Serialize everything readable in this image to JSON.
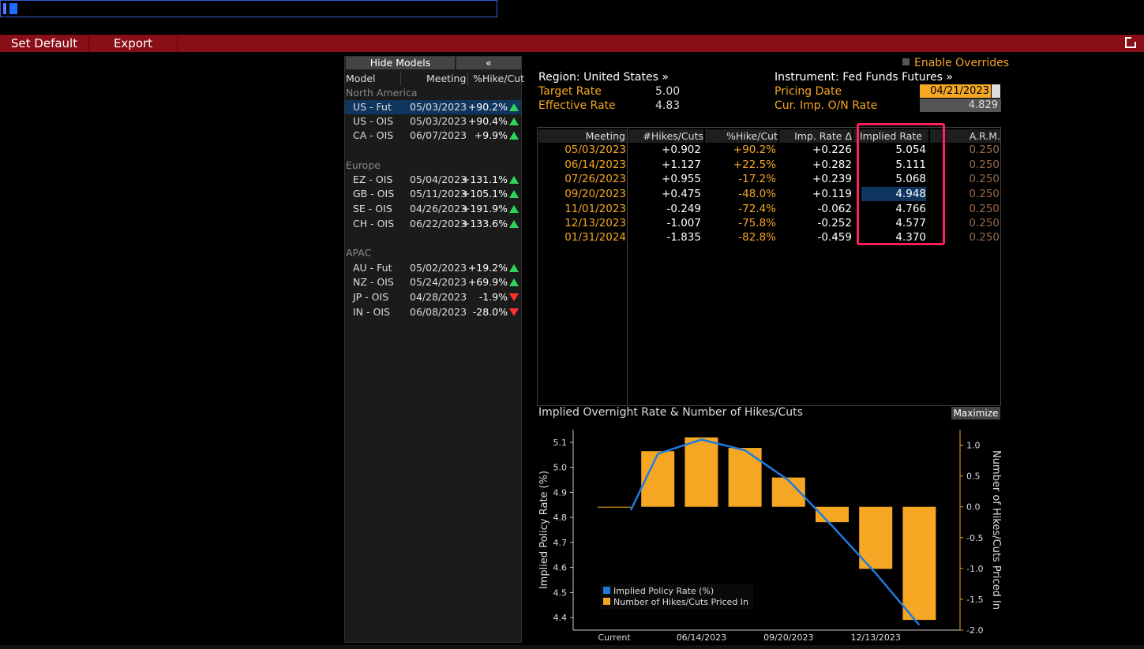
{
  "toolbar": {
    "set_default": "Set Default",
    "export": "Export",
    "popout_icon": "popout-icon"
  },
  "models": {
    "hide_models": "Hide Models",
    "collapse": "«",
    "headers": {
      "model": "Model",
      "meeting": "Meeting",
      "pct": "%Hike/Cut"
    },
    "regions": [
      {
        "name": "North America",
        "rows": [
          {
            "model": "US - Fut",
            "meeting": "05/03/2023",
            "pct": "+90.2%",
            "dir": "up",
            "selected": true
          },
          {
            "model": "US - OIS",
            "meeting": "05/03/2023",
            "pct": "+90.4%",
            "dir": "up"
          },
          {
            "model": "CA - OIS",
            "meeting": "06/07/2023",
            "pct": "+9.9%",
            "dir": "up"
          }
        ]
      },
      {
        "name": "Europe",
        "rows": [
          {
            "model": "EZ - OIS",
            "meeting": "05/04/2023",
            "pct": "+131.1%",
            "dir": "up"
          },
          {
            "model": "GB - OIS",
            "meeting": "05/11/2023",
            "pct": "+105.1%",
            "dir": "up"
          },
          {
            "model": "SE - OIS",
            "meeting": "04/26/2023",
            "pct": "+191.9%",
            "dir": "up"
          },
          {
            "model": "CH - OIS",
            "meeting": "06/22/2023",
            "pct": "+133.6%",
            "dir": "up"
          }
        ]
      },
      {
        "name": "APAC",
        "rows": [
          {
            "model": "AU - Fut",
            "meeting": "05/02/2023",
            "pct": "+19.2%",
            "dir": "up"
          },
          {
            "model": "NZ - OIS",
            "meeting": "05/24/2023",
            "pct": "+69.9%",
            "dir": "up"
          },
          {
            "model": "JP - OIS",
            "meeting": "04/28/2023",
            "pct": "-1.9%",
            "dir": "down"
          },
          {
            "model": "IN - OIS",
            "meeting": "06/08/2023",
            "pct": "-28.0%",
            "dir": "down"
          }
        ]
      }
    ]
  },
  "info": {
    "enable_overrides": "Enable Overrides",
    "region": "Region: United States »",
    "target_rate_label": "Target Rate",
    "target_rate": "5.00",
    "effective_rate_label": "Effective Rate",
    "effective_rate": "4.83",
    "instrument": "Instrument: Fed Funds Futures »",
    "pricing_date_label": "Pricing Date",
    "pricing_date": "04/21/2023",
    "onrate_label": "Cur. Imp. O/N Rate",
    "onrate": "4.829"
  },
  "table": {
    "headers": [
      "Meeting",
      "#Hikes/Cuts",
      "%Hike/Cut",
      "Imp. Rate Δ",
      "Implied Rate",
      "A.R.M."
    ],
    "rows": [
      [
        "05/03/2023",
        "+0.902",
        "+90.2%",
        "+0.226",
        "5.054",
        "0.250"
      ],
      [
        "06/14/2023",
        "+1.127",
        "+22.5%",
        "+0.282",
        "5.111",
        "0.250"
      ],
      [
        "07/26/2023",
        "+0.955",
        "-17.2%",
        "+0.239",
        "5.068",
        "0.250"
      ],
      [
        "09/20/2023",
        "+0.475",
        "-48.0%",
        "+0.119",
        "4.948",
        "0.250"
      ],
      [
        "11/01/2023",
        "-0.249",
        "-72.4%",
        "-0.062",
        "4.766",
        "0.250"
      ],
      [
        "12/13/2023",
        "-1.007",
        "-75.8%",
        "-0.252",
        "4.577",
        "0.250"
      ],
      [
        "01/31/2024",
        "-1.835",
        "-82.8%",
        "-0.459",
        "4.370",
        "0.250"
      ]
    ]
  },
  "chart": {
    "title": "Implied Overnight Rate & Number of Hikes/Cuts",
    "maximize": "Maximize"
  },
  "chart_data": {
    "type": "bar",
    "categories": [
      "Current",
      "05/03/2023",
      "06/14/2023",
      "07/26/2023",
      "09/20/2023",
      "11/01/2023",
      "12/13/2023",
      "01/31/2024"
    ],
    "x_tick_labels": [
      "Current",
      "06/14/2023",
      "09/20/2023",
      "12/13/2023"
    ],
    "series": [
      {
        "name": "Implied Policy Rate (%)",
        "type": "line",
        "axis": "left",
        "color": "#1f7ae0",
        "values": [
          4.829,
          5.054,
          5.111,
          5.068,
          4.948,
          4.766,
          4.577,
          4.37
        ]
      },
      {
        "name": "Number of Hikes/Cuts Priced In",
        "type": "bar",
        "axis": "right",
        "color": "#f5a623",
        "values": [
          0.0,
          0.902,
          1.127,
          0.955,
          0.475,
          -0.249,
          -1.007,
          -1.835
        ]
      }
    ],
    "ylabel": "Implied Policy Rate (%)",
    "ylabel_right": "Number of Hikes/Cuts Priced In",
    "ylim": [
      4.35,
      5.15
    ],
    "yticks": [
      "5.1",
      "5.0",
      "4.9",
      "4.8",
      "4.7",
      "4.6",
      "4.5",
      "4.4"
    ],
    "ylim_right": [
      -2.0,
      1.25
    ],
    "yticks_right": [
      "1.0",
      "0.5",
      "0.0",
      "-0.5",
      "-1.0",
      "-1.5",
      "-2.0"
    ],
    "legend_position": "bottom-left",
    "grid": false
  }
}
